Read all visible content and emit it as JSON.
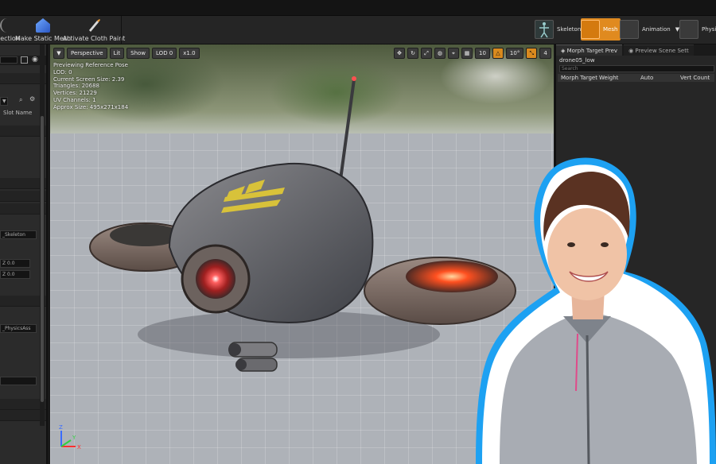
{
  "toolbar": {
    "buttons": [
      {
        "label": "election",
        "icon": "selection-icon"
      },
      {
        "label": "Make Static Mesh",
        "icon": "static-mesh-icon"
      },
      {
        "label": "Activate Cloth Paint",
        "icon": "cloth-brush-icon"
      }
    ],
    "modes": [
      {
        "label": "Skeleton",
        "active": false
      },
      {
        "label": "Mesh",
        "active": true
      },
      {
        "label": "Animation",
        "active": false
      },
      {
        "label": "Physic",
        "active": false
      }
    ],
    "accent_color": "#e08a1f"
  },
  "left_panel": {
    "slot_header": "Slot Name",
    "skeleton_field": "_Skeleton",
    "z_fields": [
      "Z 0.0",
      "Z 0.0"
    ],
    "physics_field": "_PhysicsAss"
  },
  "viewport": {
    "toolbar": {
      "perspective": "Perspective",
      "lit": "Lit",
      "show": "Show",
      "lod": "LOD 0",
      "speed": "x1.0",
      "snap_grid": "10",
      "snap_angle": "10°",
      "camera_speed": "4"
    },
    "stats": {
      "title": "Previewing Reference Pose",
      "lines": [
        "LOD: 0",
        "Current Screen Size: 2.39",
        "Triangles: 20688",
        "Vertices: 21229",
        "UV Channels: 1",
        "Approx Size: 495x271x184"
      ]
    },
    "axis_labels": [
      "X",
      "Y",
      "Z"
    ]
  },
  "right_panel": {
    "tabs": [
      "Morph Target Prev",
      "Preview Scene Sett"
    ],
    "mesh_name": "drone05_low",
    "search_placeholder": "Search",
    "columns": [
      "Morph Target N",
      "Weight",
      "Auto",
      "Vert Count"
    ]
  }
}
